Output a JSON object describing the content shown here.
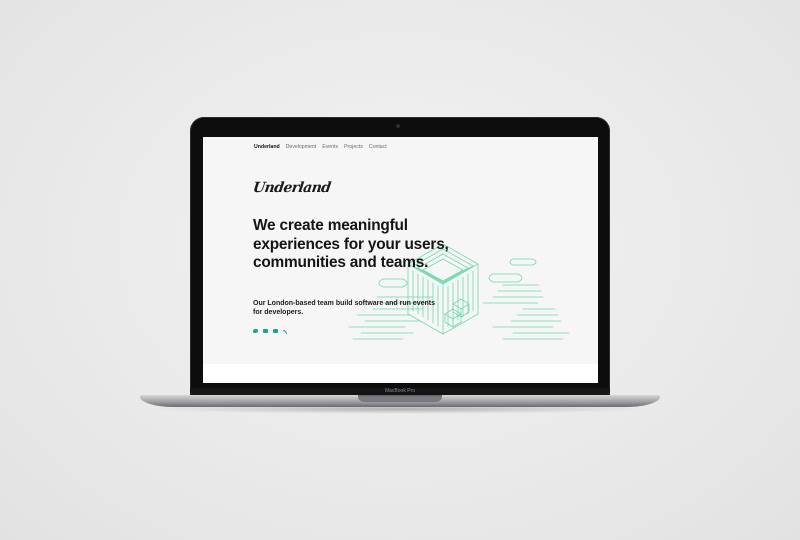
{
  "device": {
    "model_label": "MacBook Pro"
  },
  "nav": {
    "brand": "Underland",
    "items": [
      "Development",
      "Events",
      "Projects",
      "Contact"
    ]
  },
  "hero": {
    "logo_text": "Underland",
    "headline": "We create meaningful experiences for your users, communities and teams.",
    "subheading": "Our London-based team build software and run events for developers.",
    "social_icons": [
      "twitter-icon",
      "github-icon",
      "email-icon",
      "rss-icon"
    ]
  },
  "colors": {
    "accent": "#1fa48c",
    "illustration_green": "#5fd7a1"
  }
}
